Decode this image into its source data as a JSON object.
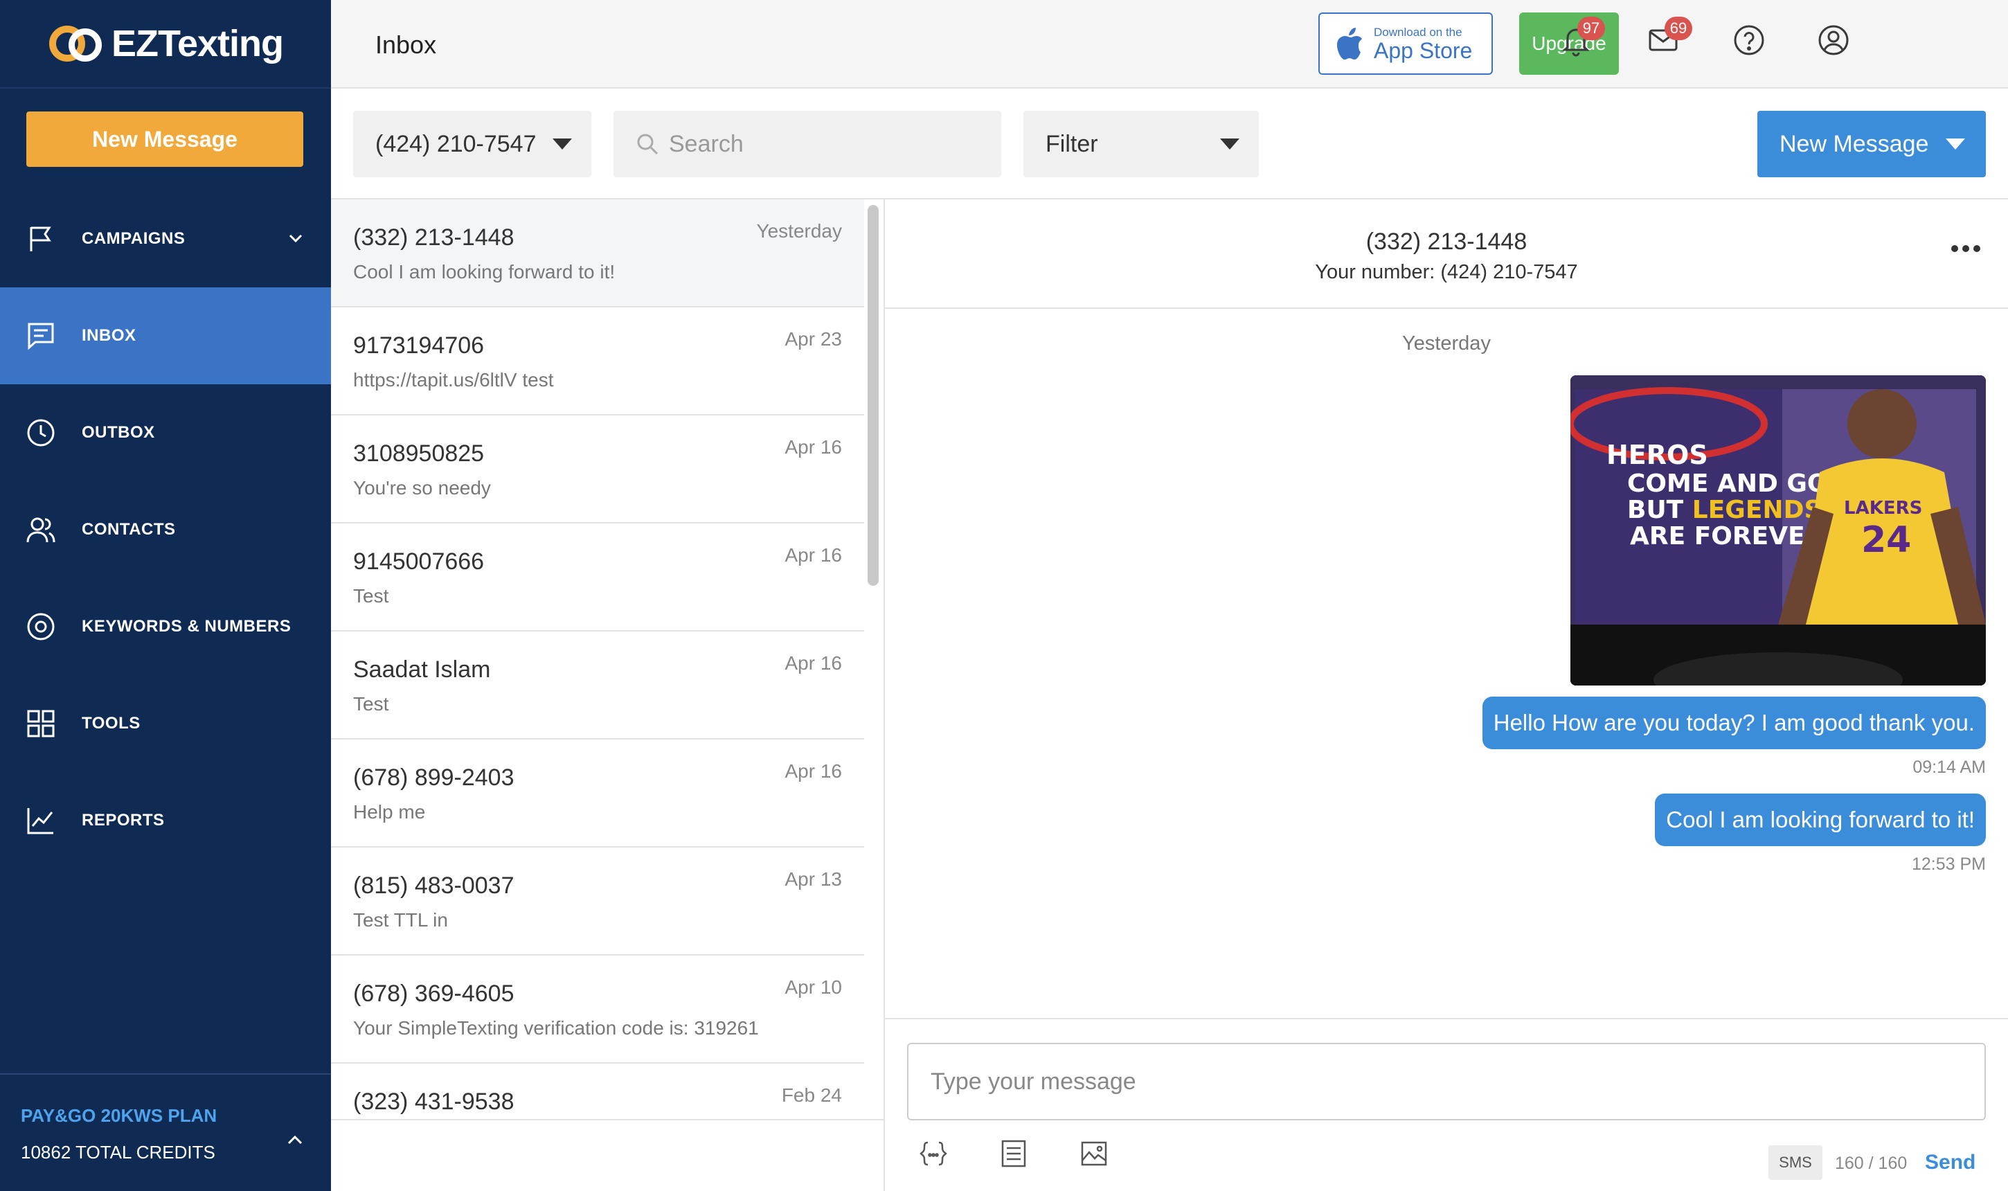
{
  "brand": {
    "logo_ez": "EZ",
    "logo_texting": "Texting"
  },
  "sidebar": {
    "new_message": "New Message",
    "items": [
      {
        "label": "CAMPAIGNS",
        "icon": "flag-icon",
        "has_chevron": true
      },
      {
        "label": "INBOX",
        "icon": "chat-icon",
        "active": true
      },
      {
        "label": "OUTBOX",
        "icon": "clock-icon"
      },
      {
        "label": "CONTACTS",
        "icon": "users-icon"
      },
      {
        "label": "KEYWORDS & NUMBERS",
        "icon": "target-icon"
      },
      {
        "label": "TOOLS",
        "icon": "grid-icon"
      },
      {
        "label": "REPORTS",
        "icon": "chart-icon"
      }
    ],
    "plan": {
      "name": "PAY&GO 20KWS PLAN",
      "credits": "10862 TOTAL CREDITS"
    }
  },
  "header": {
    "title": "Inbox",
    "appstore_small": "Download on the",
    "appstore_big": "App Store",
    "upgrade": "Upgrade",
    "notifications_count": "97",
    "mail_count": "69"
  },
  "filters": {
    "number": "(424) 210-7547",
    "search_placeholder": "Search",
    "filter": "Filter",
    "new_message": "New Message"
  },
  "conversations": [
    {
      "name": "(332) 213-1448",
      "date": "Yesterday",
      "snippet": "Cool I am looking forward to it!",
      "selected": true
    },
    {
      "name": "9173194706",
      "date": "Apr 23",
      "snippet": "https://tapit.us/6ltlV test"
    },
    {
      "name": "3108950825",
      "date": "Apr 16",
      "snippet": "You're so needy"
    },
    {
      "name": "9145007666",
      "date": "Apr 16",
      "snippet": "Test"
    },
    {
      "name": "Saadat Islam",
      "date": "Apr 16",
      "snippet": "Test"
    },
    {
      "name": "(678) 899-2403",
      "date": "Apr 16",
      "snippet": "Help me"
    },
    {
      "name": "(815) 483-0037",
      "date": "Apr 13",
      "snippet": "Test TTL in"
    },
    {
      "name": "(678) 369-4605",
      "date": "Apr 10",
      "snippet": "Your SimpleTexting verification code is: 319261"
    },
    {
      "name": "(323) 431-9538",
      "date": "Feb 24",
      "snippet": ""
    }
  ],
  "chat": {
    "contact": "(332) 213-1448",
    "your_number": "Your number: (424) 210-7547",
    "day": "Yesterday",
    "image_text": {
      "line1": "HEROS",
      "line2": "COME AND GO,",
      "line3a": "BUT ",
      "line3b": "LEGENDS",
      "line4": "ARE FOREVER.",
      "jersey": "LAKERS",
      "jersey_number": "24"
    },
    "messages": [
      {
        "text": "Hello How are you today? I am good thank you.",
        "time": "09:14 AM"
      },
      {
        "text": "Cool I am looking forward to it!",
        "time": "12:53 PM"
      }
    ],
    "composer_placeholder": "Type your message",
    "sms": "SMS",
    "count": "160 / 160",
    "send": "Send"
  },
  "colors": {
    "sidebar": "#0f2a53",
    "active": "#3b74c5",
    "accent": "#f0a93a",
    "primary": "#3b8dd9",
    "upgrade": "#5cb85c",
    "badge": "#d9534f"
  }
}
